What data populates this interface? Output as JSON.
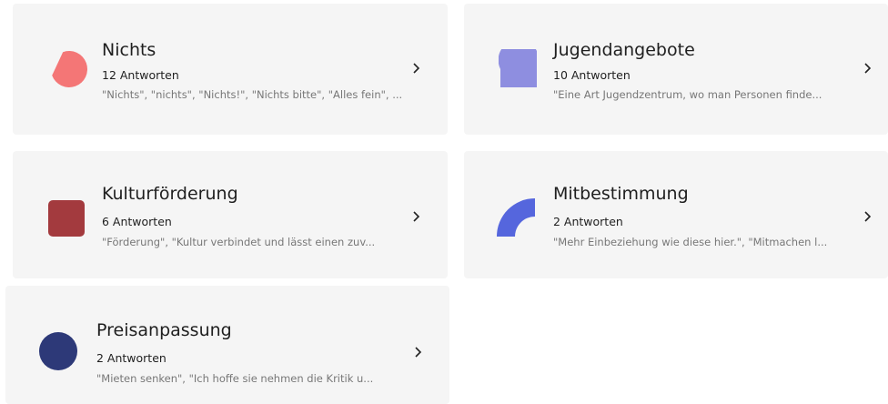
{
  "cards": [
    {
      "title": "Nichts",
      "count": "12 Antworten",
      "snippet": "\"Nichts\", \"nichts\", \"Nichts!\", \"Nichts bitte\", \"Alles fein\", ...",
      "icon": "half-circle-icon",
      "color": "#f47676"
    },
    {
      "title": "Jugendangebote",
      "count": "10 Antworten",
      "snippet": "\"Eine Art Jugendzentrum, wo man Personen finde...",
      "icon": "quarter-circle-icon",
      "color": "#8e8ee0"
    },
    {
      "title": "Kulturförderung",
      "count": "6 Antworten",
      "snippet": "\"Förderung\", \"Kultur verbindet und lässt einen zuv...",
      "icon": "rounded-square-icon",
      "color": "#a33a3e"
    },
    {
      "title": "Mitbestimmung",
      "count": "2 Antworten",
      "snippet": "\"Mehr Einbeziehung wie diese hier.\", \"Mitmachen l...",
      "icon": "arc-icon",
      "color": "#5566dd"
    },
    {
      "title": "Preisanpassung",
      "count": "2 Antworten",
      "snippet": "\"Mieten senken\", \"Ich hoffe sie nehmen die Kritik u...",
      "icon": "circle-icon",
      "color": "#2d3978"
    }
  ]
}
